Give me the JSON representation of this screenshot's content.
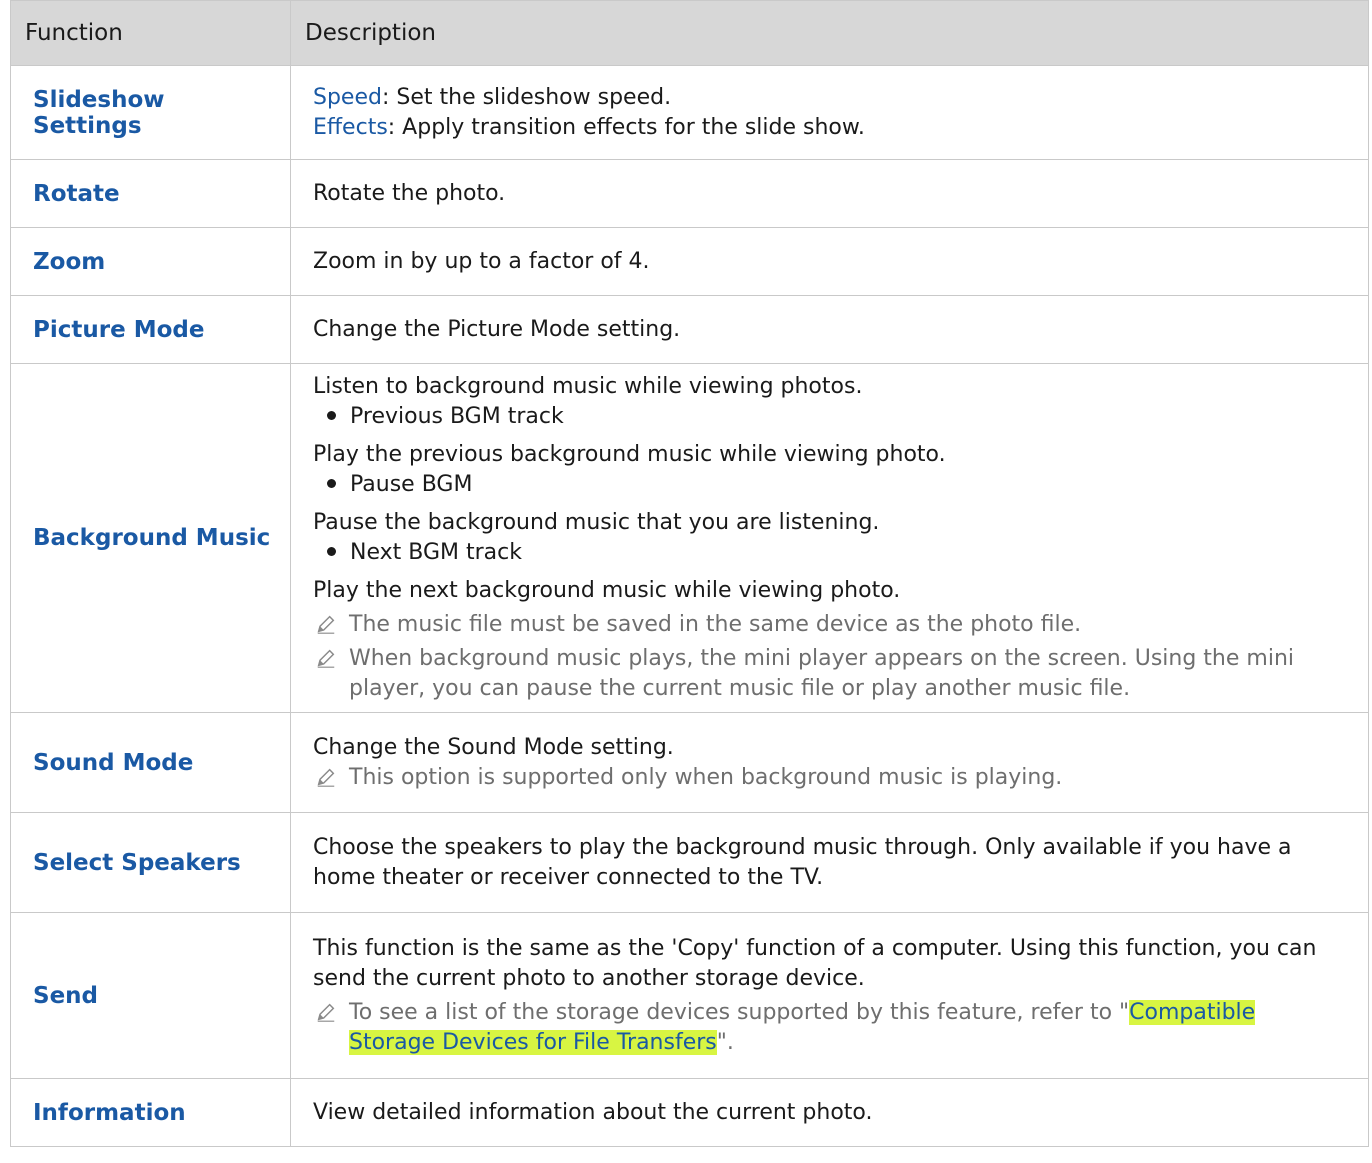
{
  "headers": {
    "function": "Function",
    "description": "Description"
  },
  "rows": {
    "slideshow": {
      "name": "Slideshow Settings",
      "speed_kw": "Speed",
      "speed_text": ": Set the slideshow speed.",
      "effects_kw": "Effects",
      "effects_text": ": Apply transition effects for the slide show."
    },
    "rotate": {
      "name": "Rotate",
      "desc": "Rotate the photo."
    },
    "zoom": {
      "name": "Zoom",
      "desc": "Zoom in by up to a factor of 4."
    },
    "picture_mode": {
      "name": "Picture Mode",
      "desc": "Change the Picture Mode setting."
    },
    "background_music": {
      "name": "Background Music",
      "intro": "Listen to background music while viewing photos.",
      "items": [
        {
          "bullet": "Previous BGM track",
          "text": "Play the previous background music while viewing photo."
        },
        {
          "bullet": "Pause BGM",
          "text": "Pause the background music that you are listening."
        },
        {
          "bullet": "Next BGM track",
          "text": "Play the next background music while viewing photo."
        }
      ],
      "notes": [
        "The music file must be saved in the same device as the photo file.",
        "When background music plays, the mini player appears on the screen. Using the mini player, you can pause the current music file or play another music file."
      ]
    },
    "sound_mode": {
      "name": "Sound Mode",
      "desc": "Change the Sound Mode setting.",
      "note": "This option is supported only when background music is playing."
    },
    "select_speakers": {
      "name": "Select Speakers",
      "desc": "Choose the speakers to play the background music through. Only available if you have a home theater or receiver connected to the TV."
    },
    "send": {
      "name": "Send",
      "desc": "This function is the same as the 'Copy' function of a computer. Using this function, you can send the current photo to another storage device.",
      "note_prefix": "To see a list of the storage devices supported by this feature, refer to \"",
      "note_link": "Compatible Storage Devices for File Transfers",
      "note_suffix": "\"."
    },
    "information": {
      "name": "Information",
      "desc": "View detailed information about the current photo."
    }
  },
  "colors": {
    "accent": "#1a59a4",
    "header_bg": "#d7d7d7",
    "note_text": "#6e6e6e",
    "highlight": "#d8f542"
  },
  "icons": {
    "note": "pencil-icon"
  }
}
